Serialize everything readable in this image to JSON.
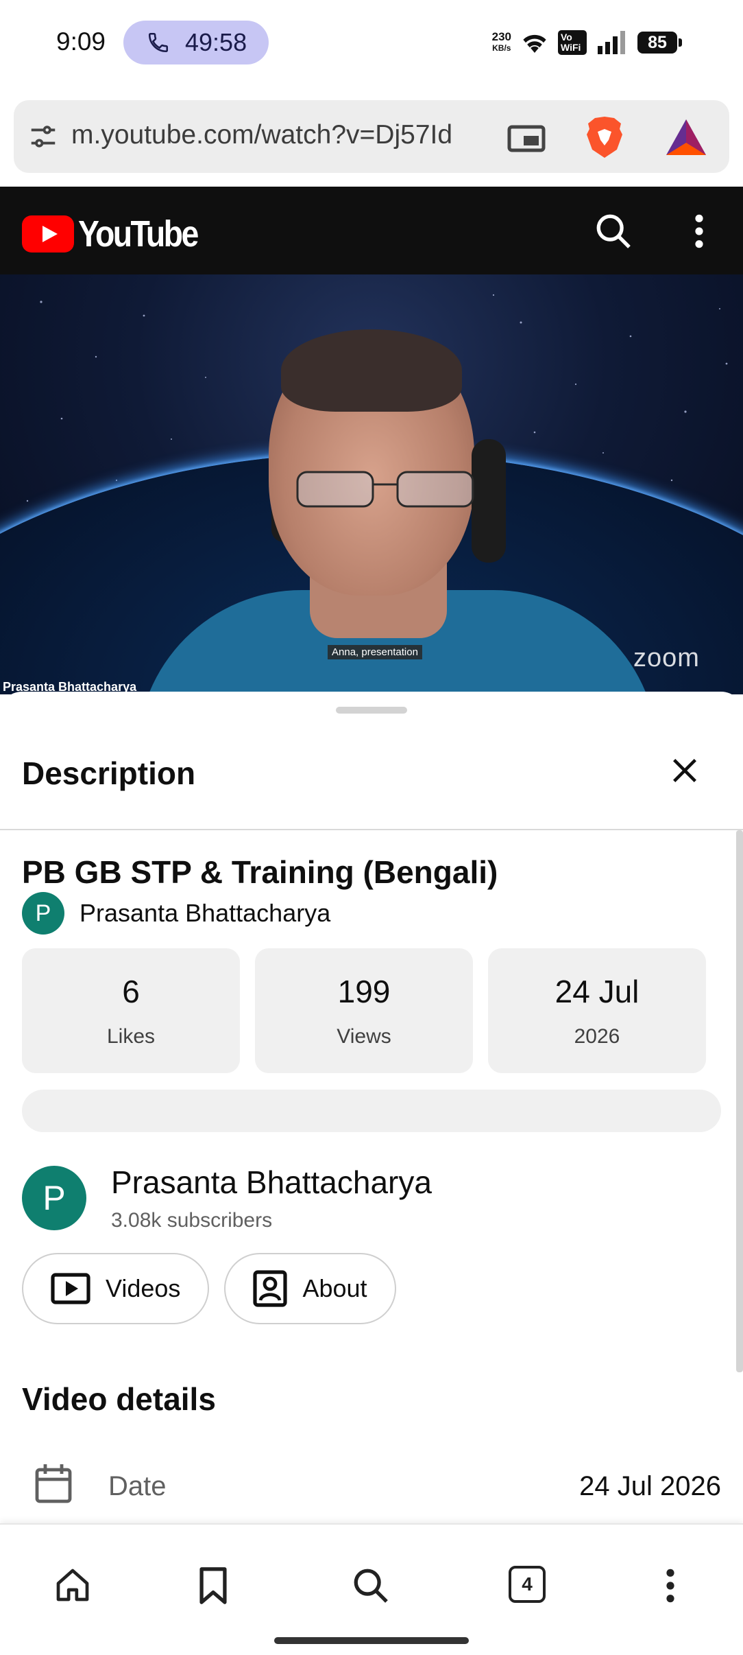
{
  "status_bar": {
    "time": "9:09",
    "call_timer": "49:58",
    "net_speed_value": "230",
    "net_speed_unit": "KB/s",
    "vowifi_top": "Vo",
    "vowifi_bottom": "WiFi",
    "battery": "85"
  },
  "browser": {
    "url": "m.youtube.com/watch?v=Dj57Id",
    "tab_count": "4"
  },
  "youtube": {
    "logo_text": "YouTube",
    "colors": {
      "brand_red": "#ff0000",
      "avatar_teal": "#0f7f6f"
    }
  },
  "video": {
    "participant_name": "Prasanta Bhattacharya",
    "caption": "Anna, presentation",
    "watermark": "zoom"
  },
  "description_panel": {
    "title": "Description",
    "video_title": "PB GB STP & Training (Bengali)",
    "channel_initial": "P",
    "channel_name": "Prasanta Bhattacharya",
    "stats": [
      {
        "value": "6",
        "label": "Likes"
      },
      {
        "value": "199",
        "label": "Views"
      },
      {
        "value": "24 Jul",
        "label": "2026"
      }
    ],
    "channel_card": {
      "initial": "P",
      "name": "Prasanta Bhattacharya",
      "subscribers": "3.08k subscribers"
    },
    "buttons": {
      "videos": "Videos",
      "about": "About"
    },
    "details_title": "Video details",
    "date_row": {
      "label": "Date",
      "value": "24 Jul 2026"
    }
  },
  "icons": {
    "url_left": "tune-icon",
    "pip": "picture-in-picture-icon",
    "brave": "brave-lion-icon",
    "bat": "bat-triangle-icon",
    "search": "search-icon",
    "more": "more-vert-icon",
    "close": "close-icon",
    "videos": "play-box-icon",
    "about": "person-box-icon",
    "date": "calendar-icon",
    "home": "home-icon",
    "bookmark": "bookmark-icon"
  }
}
